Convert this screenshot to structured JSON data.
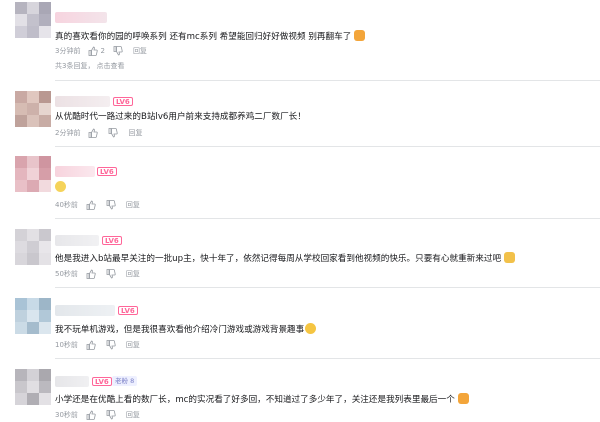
{
  "comments": [
    {
      "text": "真的喜欢看你的园的呼唤系列 还有mc系列 希望能回归好好做视频 别再翻车了",
      "time": "3分钟前",
      "likes": "2",
      "reply": "回复",
      "sub_count": "共3条回复，",
      "sub_link": "点击查看"
    },
    {
      "level": "LV6",
      "text": "从优酷时代一路过来的B站lv6用户前来支持成都养鸡二厂数厂长！",
      "time": "2分钟前",
      "reply": "回复"
    },
    {
      "level": "LV6",
      "text": "",
      "time": "40秒前",
      "reply": "回复"
    },
    {
      "level": "LV6",
      "text": "他是我进入b站最早关注的一批up主，快十年了，依然记得每周从学校回家看到他视频的快乐。只要有心就重新来过吧",
      "time": "50秒前",
      "reply": "回复"
    },
    {
      "level": "LV6",
      "text": "我不玩单机游戏，但是我很喜欢看他介绍冷门游戏或游戏背景趣事",
      "time": "10秒前",
      "reply": "回复"
    },
    {
      "level": "LV6",
      "badge": "老粉 8",
      "text": "小学还是在优酷上看的数厂长，mc的实况看了好多回，不知道过了多少年了，关注还是我列表里最后一个",
      "time": "30秒前",
      "reply": "回复"
    }
  ]
}
